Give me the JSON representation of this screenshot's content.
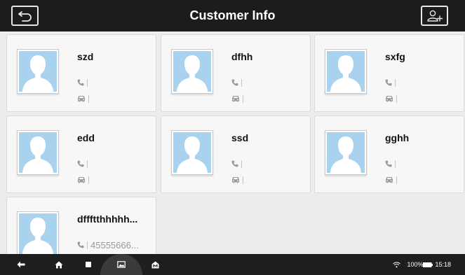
{
  "header": {
    "title": "Customer Info",
    "back_icon": "back-arrow-icon",
    "add_icon": "add-customer-icon"
  },
  "customers": [
    {
      "name": "szd",
      "phone": ""
    },
    {
      "name": "dfhh",
      "phone": ""
    },
    {
      "name": "sxfg",
      "phone": ""
    },
    {
      "name": "edd",
      "phone": ""
    },
    {
      "name": "ssd",
      "phone": ""
    },
    {
      "name": "gghh",
      "phone": ""
    },
    {
      "name": "dffftthhhhh...",
      "phone": "45555666..."
    }
  ],
  "navbar": {
    "icons": [
      "back-icon",
      "home-icon",
      "recent-apps-icon",
      "gallery-icon",
      "store-icon"
    ]
  },
  "status": {
    "battery": "100%",
    "time": "15:18"
  },
  "colors": {
    "titlebar": "#1c1c1c",
    "background": "#ececec",
    "card": "#f7f7f7",
    "avatar": "#a9d2ee"
  }
}
